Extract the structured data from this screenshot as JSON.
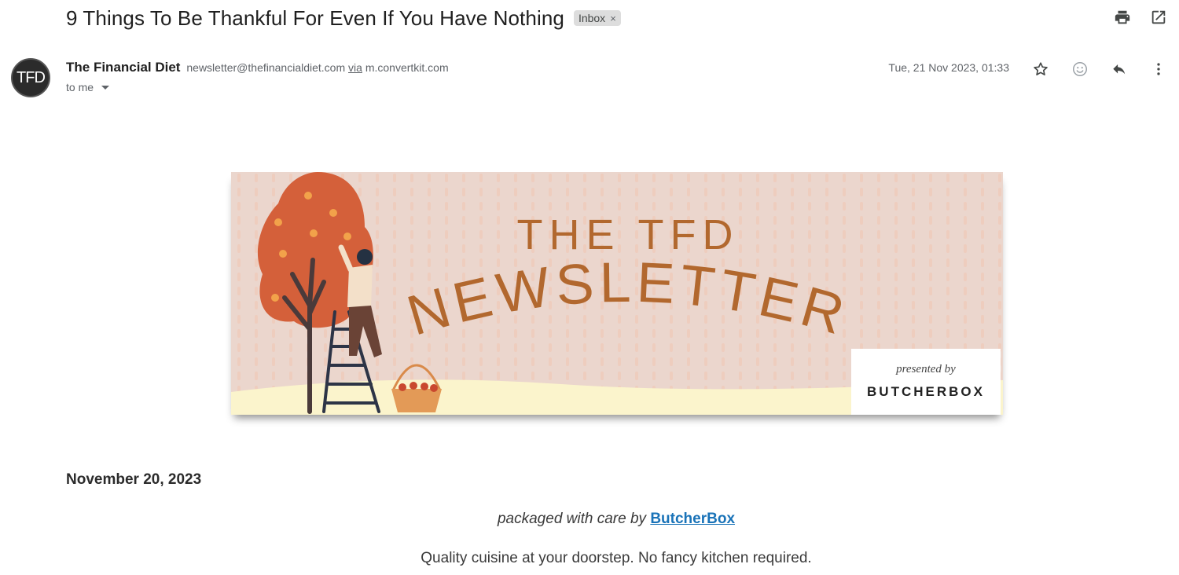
{
  "email": {
    "subject": "9 Things To Be Thankful For Even If You Have Nothing",
    "label": "Inbox",
    "label_remove": "×",
    "sender_name": "The Financial Diet",
    "sender_email": "newsletter@thefinancialdiet.com",
    "via_text": "via",
    "via_domain": "m.convertkit.com",
    "recipient": "to me",
    "timestamp": "Tue, 21 Nov 2023, 01:33",
    "avatar_initials": "TFD"
  },
  "banner": {
    "line1": "THE TFD",
    "line2": "NEWSLETTER",
    "presented_by": "presented by",
    "sponsor": "BUTCHERBOX"
  },
  "body": {
    "date": "November 20, 2023",
    "packaged_prefix": "packaged with care by",
    "packaged_link": "ButcherBox",
    "tagline": "Quality cuisine at your doorstep. No fancy kitchen required."
  },
  "icons": {
    "print": "print-icon",
    "open_new_window": "open-in-new-icon",
    "star": "star-icon",
    "emoji": "emoji-icon",
    "reply": "reply-icon",
    "more": "more-vert-icon"
  }
}
